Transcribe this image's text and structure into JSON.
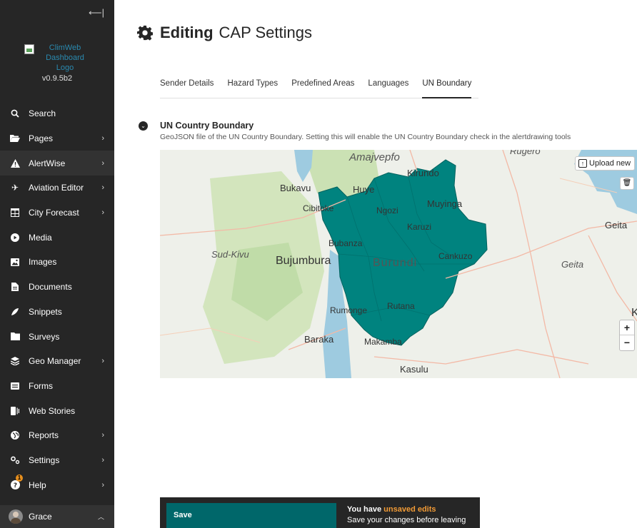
{
  "sidebar": {
    "collapse_icon": "collapse-left-icon",
    "logo_alt": "ClimWeb Dashboard Logo",
    "version": "v0.9.5b2",
    "items": [
      {
        "label": "Search",
        "icon": "search-icon",
        "chevron": false
      },
      {
        "label": "Pages",
        "icon": "folder-open-icon",
        "chevron": true
      },
      {
        "label": "AlertWise",
        "icon": "warning-icon",
        "chevron": true
      },
      {
        "label": "Aviation Editor",
        "icon": "plane-icon",
        "chevron": true
      },
      {
        "label": "City Forecast",
        "icon": "table-icon",
        "chevron": true
      },
      {
        "label": "Media",
        "icon": "play-icon",
        "chevron": false
      },
      {
        "label": "Images",
        "icon": "image-icon",
        "chevron": false
      },
      {
        "label": "Documents",
        "icon": "document-icon",
        "chevron": false
      },
      {
        "label": "Snippets",
        "icon": "snippet-icon",
        "chevron": false
      },
      {
        "label": "Surveys",
        "icon": "folder-icon",
        "chevron": false
      },
      {
        "label": "Geo Manager",
        "icon": "layers-icon",
        "chevron": true
      },
      {
        "label": "Forms",
        "icon": "form-icon",
        "chevron": false
      },
      {
        "label": "Web Stories",
        "icon": "stories-icon",
        "chevron": false
      },
      {
        "label": "Reports",
        "icon": "globe-icon",
        "chevron": true
      },
      {
        "label": "Settings",
        "icon": "cogs-icon",
        "chevron": true
      },
      {
        "label": "Help",
        "icon": "help-icon",
        "chevron": true,
        "badge": "1"
      }
    ],
    "user": {
      "name": "Grace",
      "chevron": "^"
    }
  },
  "header": {
    "title_strong": "Editing",
    "title_rest": "CAP Settings",
    "icon": "gear-icon"
  },
  "tabs": [
    {
      "label": "Sender Details",
      "active": false
    },
    {
      "label": "Hazard Types",
      "active": false
    },
    {
      "label": "Predefined Areas",
      "active": false
    },
    {
      "label": "Languages",
      "active": false
    },
    {
      "label": "UN Boundary",
      "active": true
    }
  ],
  "section": {
    "title": "UN Country Boundary",
    "help": "GeoJSON file of the UN Country Boundary. Setting this will enable the UN Country Boundary check in the alertdrawing tools"
  },
  "map": {
    "upload_label": "Upload new",
    "zoom_in": "+",
    "zoom_out": "−",
    "boundary_color": "#00837f",
    "labels": {
      "amajvepfo": "Amajvepfo",
      "rugero": "Rugero",
      "kirundo": "Kirundo",
      "bukavu": "Bukavu",
      "huye": "Huye",
      "muyinga": "Muyinga",
      "geita_top": "Geita",
      "cibitoke": "Cibitoke",
      "ngozi": "Ngozi",
      "karuzi": "Karuzi",
      "bubanza": "Bubanza",
      "sud_kivu": "Sud-Kivu",
      "bujumbura": "Bujumbura",
      "burundi": "Burundi",
      "cankuzo": "Cankuzo",
      "geita": "Geita",
      "rumonge": "Rumonge",
      "rutana": "Rutana",
      "k": "K",
      "baraka": "Baraka",
      "makamba": "Makamba",
      "kasulu": "Kasulu"
    }
  },
  "save_bar": {
    "save_label": "Save",
    "msg_prefix": "You have ",
    "msg_accent": "unsaved edits",
    "msg_line2": "Save your changes before leaving",
    "accent_color": "#f29b36"
  }
}
